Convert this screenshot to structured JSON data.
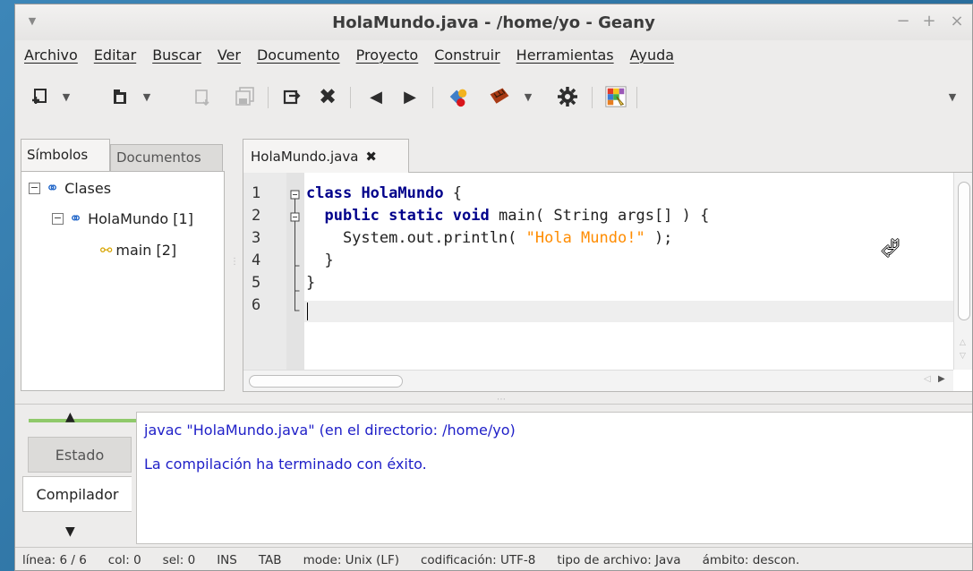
{
  "window": {
    "title": "HolaMundo.java - /home/yo - Geany",
    "controls": {
      "minimize": "−",
      "maximize": "+",
      "close": "×"
    }
  },
  "menubar": [
    "Archivo",
    "Editar",
    "Buscar",
    "Ver",
    "Documento",
    "Proyecto",
    "Construir",
    "Herramientas",
    "Ayuda"
  ],
  "toolbar": {
    "icons": [
      "new-file-icon",
      "open-file-icon",
      "save-icon",
      "save-all-icon",
      "reload-icon",
      "close-file-icon",
      "back-icon",
      "forward-icon",
      "compile-icon",
      "build-icon",
      "execute-icon",
      "preferences-icon",
      "color-chooser-icon"
    ]
  },
  "sidebar": {
    "tabs": {
      "symbols": "Símbolos",
      "documents": "Documentos"
    },
    "tree": {
      "classes": "Clases",
      "class_item": "HolaMundo [1]",
      "method_item": "main [2]"
    }
  },
  "editor": {
    "tab_label": "HolaMundo.java",
    "line_numbers": [
      "1",
      "2",
      "3",
      "4",
      "5",
      "6"
    ],
    "code": {
      "l1_kw": "class",
      "l1_name": "HolaMundo",
      "l1_rest": " {",
      "l2_indent": "  ",
      "l2_kw": "public static void",
      "l2_rest": " main( String args[] ) {",
      "l3_pre": "    System.out.println( ",
      "l3_str": "\"Hola Mundo!\"",
      "l3_post": " );",
      "l4": "  }",
      "l5": "}"
    }
  },
  "messages": {
    "tabs": {
      "status": "Estado",
      "compiler": "Compilador"
    },
    "lines": [
      "javac \"HolaMundo.java\" (en el directorio: /home/yo)",
      "La compilación ha terminado con éxito."
    ]
  },
  "statusbar": {
    "line": "línea: 6 / 6",
    "col": "col: 0",
    "sel": "sel: 0",
    "ins": "INS",
    "tab": "TAB",
    "mode": "mode: Unix (LF)",
    "encoding": "codificación: UTF-8",
    "filetype": "tipo de archivo: Java",
    "scope": "ámbito: descon."
  }
}
